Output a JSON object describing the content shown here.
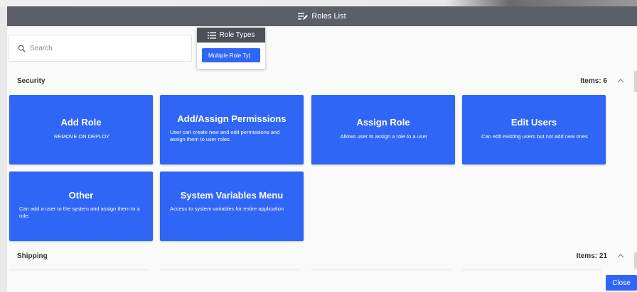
{
  "window": {
    "title": "Roles List",
    "title_icon": "playlist-edit-icon"
  },
  "search": {
    "placeholder": "Search",
    "icon": "search-icon"
  },
  "role_types": {
    "title": "Role Types",
    "icon": "list-icon",
    "selected_button": "Multiple Role Ty|"
  },
  "sections": {
    "security": {
      "title": "Security",
      "count": "Items: 6",
      "cards": [
        {
          "title": "Add Role",
          "description": "REMOVE ON DEPLOY"
        },
        {
          "title": "Add/Assign Permissions",
          "description": "User can create new and edit permissions and assign them to user roles."
        },
        {
          "title": "Assign Role",
          "description": "Allows user to assign a role to a user"
        },
        {
          "title": "Edit Users",
          "description": "Can edit existing users but not add new ones"
        },
        {
          "title": "Other",
          "description": "Can add a user to the system and assign them to a role."
        },
        {
          "title": "System Variables Menu",
          "description": "Access to system variables for entire application"
        }
      ]
    },
    "shipping": {
      "title": "Shipping",
      "count": "Items: 21"
    }
  },
  "footer": {
    "close_label": "Close"
  },
  "colors": {
    "titlebar": "#5c5f66",
    "accent": "#2f66f5",
    "background": "#fafafa"
  }
}
